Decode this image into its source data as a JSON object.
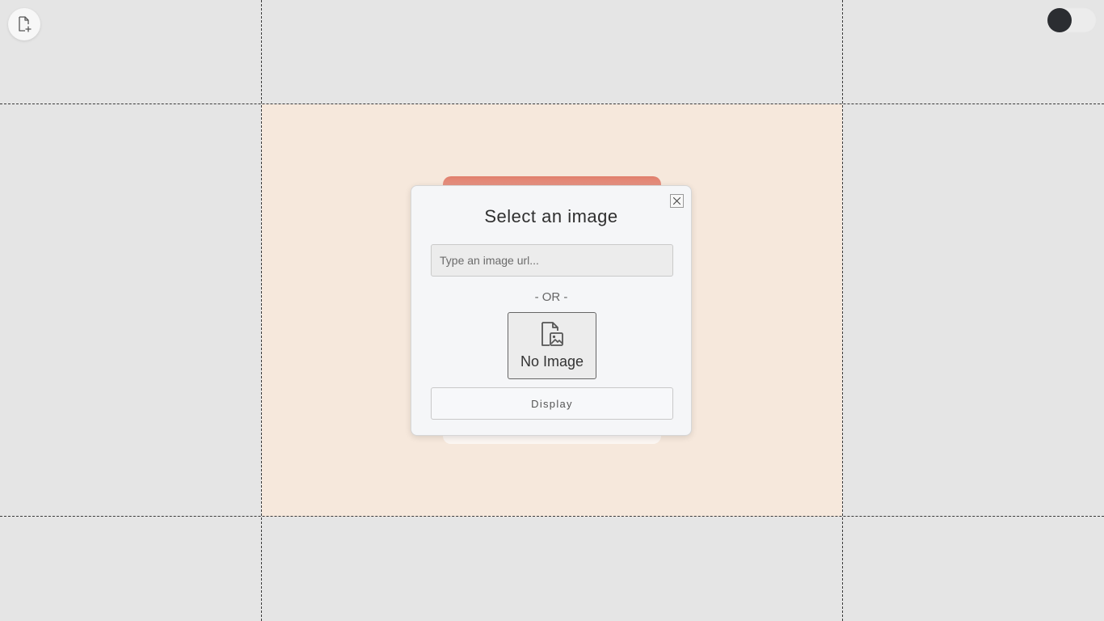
{
  "toolbar": {
    "new_document_icon": "file-plus-icon",
    "theme_toggle": {
      "state": "off",
      "knob_color": "#2b2d31"
    }
  },
  "canvas": {
    "background_color": "#f6e8dc",
    "card_header_color": "#e07e6c"
  },
  "modal": {
    "title": "Select an image",
    "close_icon": "close-icon",
    "url_input": {
      "value": "",
      "placeholder": "Type an image url..."
    },
    "separator": "- OR -",
    "image_picker": {
      "icon": "file-image-icon",
      "label": "No Image"
    },
    "display_label": "Display"
  }
}
